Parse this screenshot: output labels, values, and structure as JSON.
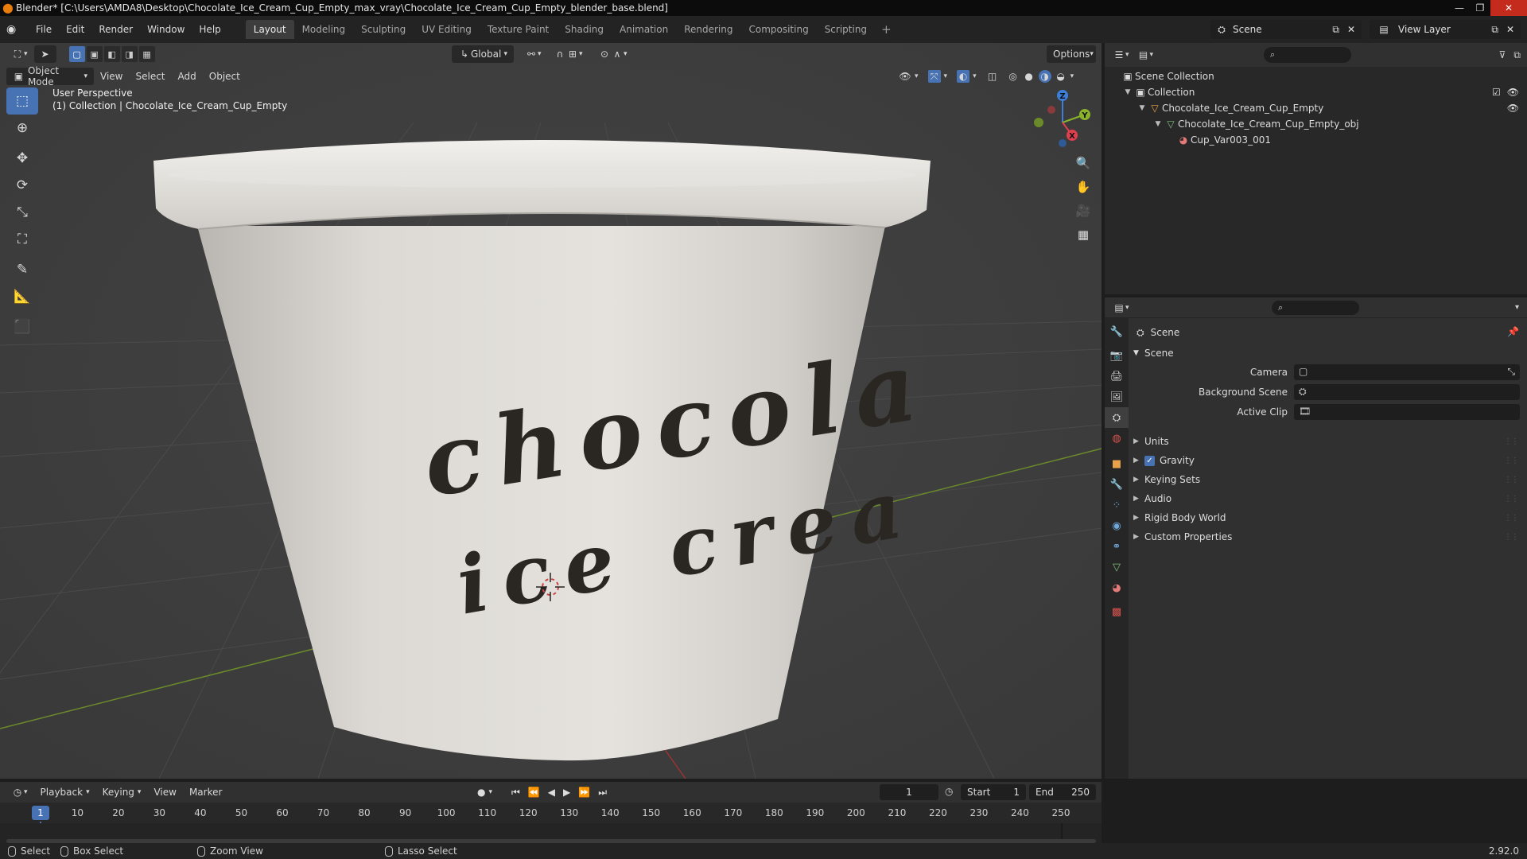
{
  "app": {
    "title": "Blender* [C:\\Users\\AMDA8\\Desktop\\Chocolate_Ice_Cream_Cup_Empty_max_vray\\Chocolate_Ice_Cream_Cup_Empty_blender_base.blend]"
  },
  "menu": [
    "File",
    "Edit",
    "Render",
    "Window",
    "Help"
  ],
  "workspaces": [
    "Layout",
    "Modeling",
    "Sculpting",
    "UV Editing",
    "Texture Paint",
    "Shading",
    "Animation",
    "Rendering",
    "Compositing",
    "Scripting"
  ],
  "scene_name": "Scene",
  "view_layer": "View Layer",
  "viewport": {
    "mode": "Object Mode",
    "menus": [
      "View",
      "Select",
      "Add",
      "Object"
    ],
    "transform_orientation": "Global",
    "options_label": "Options",
    "perspective": "User Perspective",
    "collection_info": "(1) Collection | Chocolate_Ice_Cream_Cup_Empty",
    "gizmo_axes": {
      "x": "X",
      "y": "Y",
      "z": "Z"
    },
    "cup_text_line1": "chocola",
    "cup_text_line2": "ice crea",
    "colors": {
      "background": "#3d3d3d",
      "grid_x": "#8a3a3a",
      "grid_y": "#6b8a2a",
      "cup": "#dedbd6",
      "text": "#2a2622"
    }
  },
  "tools": [
    "select-box",
    "cursor",
    "move",
    "rotate",
    "scale",
    "transform",
    "annotate",
    "measure",
    "add-cube"
  ],
  "outliner": {
    "root": "Scene Collection",
    "items": [
      {
        "label": "Collection",
        "level": 1
      },
      {
        "label": "Chocolate_Ice_Cream_Cup_Empty",
        "level": 2
      },
      {
        "label": "Chocolate_Ice_Cream_Cup_Empty_obj",
        "level": 3
      },
      {
        "label": "Cup_Var003_001",
        "level": 4
      }
    ]
  },
  "properties": {
    "context": "Scene",
    "panel_title": "Scene",
    "fields": [
      {
        "label": "Camera",
        "value": ""
      },
      {
        "label": "Background Scene",
        "value": ""
      },
      {
        "label": "Active Clip",
        "value": ""
      }
    ],
    "subpanels": [
      "Units",
      "Gravity",
      "Keying Sets",
      "Audio",
      "Rigid Body World",
      "Custom Properties"
    ],
    "gravity_checked": true
  },
  "timeline": {
    "menus": [
      "Playback",
      "Keying",
      "View",
      "Marker"
    ],
    "current_frame": "1",
    "start_label": "Start",
    "start": "1",
    "end_label": "End",
    "end": "250",
    "ticks": [
      "10",
      "20",
      "30",
      "40",
      "50",
      "60",
      "70",
      "80",
      "90",
      "100",
      "110",
      "120",
      "130",
      "140",
      "150",
      "160",
      "170",
      "180",
      "190",
      "200",
      "210",
      "220",
      "230",
      "240",
      "250"
    ]
  },
  "statusbar": {
    "select": "Select",
    "box_select": "Box Select",
    "zoom_view": "Zoom View",
    "lasso_select": "Lasso Select",
    "version": "2.92.0"
  }
}
